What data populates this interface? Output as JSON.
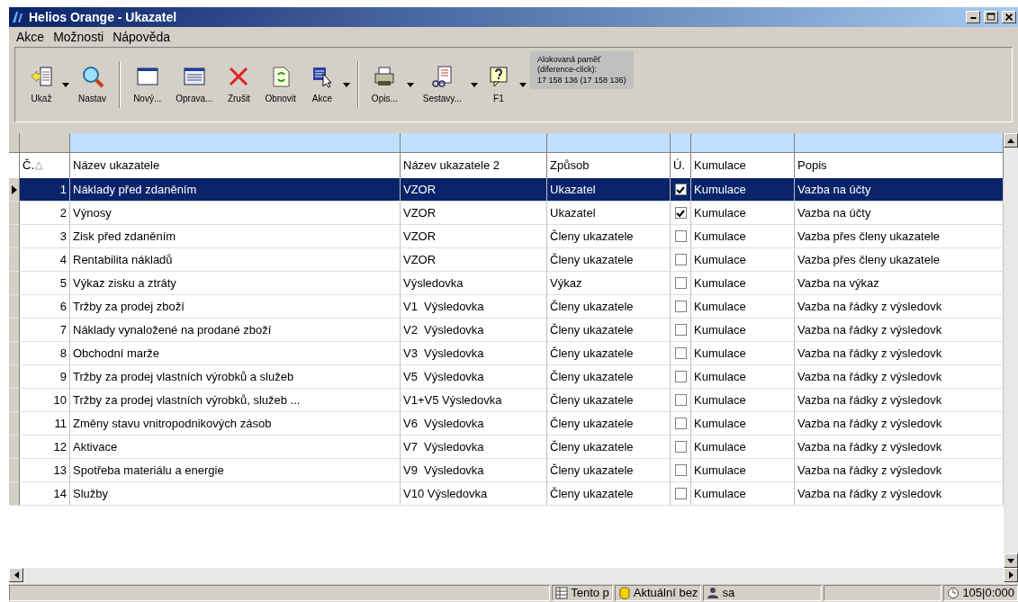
{
  "window": {
    "title": "Helios Orange - Ukazatel"
  },
  "menu": [
    "Akce",
    "Možnosti",
    "Nápověda"
  ],
  "toolbar": {
    "groups": [
      [
        {
          "label": "Ukaž",
          "dropdown": true
        },
        {
          "label": "Nastav",
          "dropdown": false
        }
      ],
      [
        {
          "label": "Nový...",
          "dropdown": false
        },
        {
          "label": "Oprava...",
          "dropdown": false
        },
        {
          "label": "Zrušit",
          "dropdown": false
        },
        {
          "label": "Obnovit",
          "dropdown": false
        },
        {
          "label": "Akce",
          "dropdown": true
        }
      ],
      [
        {
          "label": "Opis...",
          "dropdown": true
        },
        {
          "label": "Sestavy...",
          "dropdown": true
        },
        {
          "label": "F1",
          "dropdown": true
        }
      ]
    ],
    "memory": [
      "Alokovaná paměť",
      "(diference-click):",
      "17 158 136 (17 158 136)"
    ]
  },
  "table": {
    "columns": [
      "Č.",
      "Název ukazatele",
      "Název ukazatele 2",
      "Způsob",
      "Ú.",
      "Kumulace",
      "Popis"
    ],
    "rows": [
      {
        "number": "1",
        "name": "Náklady před zdaněním",
        "name2": "VZOR",
        "method": "Ukazatel",
        "checked": true,
        "cumulation": "Kumulace",
        "description": "Vazba na účty",
        "selected": true
      },
      {
        "number": "2",
        "name": "Výnosy",
        "name2": "VZOR",
        "method": "Ukazatel",
        "checked": true,
        "cumulation": "Kumulace",
        "description": "Vazba na účty",
        "selected": false
      },
      {
        "number": "3",
        "name": "Zisk před zdaněním",
        "name2": "VZOR",
        "method": "Členy ukazatele",
        "checked": false,
        "cumulation": "Kumulace",
        "description": "Vazba přes členy ukazatele",
        "selected": false
      },
      {
        "number": "4",
        "name": "Rentabilita nákladů",
        "name2": "VZOR",
        "method": "Členy ukazatele",
        "checked": false,
        "cumulation": "Kumulace",
        "description": "Vazba přes členy ukazatele",
        "selected": false
      },
      {
        "number": "5",
        "name": "Výkaz zisku a ztráty",
        "name2": "Výsledovka",
        "method": "Výkaz",
        "checked": false,
        "cumulation": "Kumulace",
        "description": "Vazba na výkaz",
        "selected": false
      },
      {
        "number": "6",
        "name": "Tržby za prodej zboží",
        "name2": "V1  Výsledovka",
        "method": "Členy ukazatele",
        "checked": false,
        "cumulation": "Kumulace",
        "description": "Vazba na řádky z výsledovk",
        "selected": false
      },
      {
        "number": "7",
        "name": "Náklady vynaložené na prodané zboží",
        "name2": "V2  Výsledovka",
        "method": "Členy ukazatele",
        "checked": false,
        "cumulation": "Kumulace",
        "description": "Vazba na řádky z výsledovk",
        "selected": false
      },
      {
        "number": "8",
        "name": "Obchodní marže",
        "name2": "V3  Výsledovka",
        "method": "Členy ukazatele",
        "checked": false,
        "cumulation": "Kumulace",
        "description": "Vazba na řádky z výsledovk",
        "selected": false
      },
      {
        "number": "9",
        "name": "Tržby za prodej vlastních výrobků a služeb",
        "name2": "V5  Výsledovka",
        "method": "Členy ukazatele",
        "checked": false,
        "cumulation": "Kumulace",
        "description": "Vazba na řádky z výsledovk",
        "selected": false
      },
      {
        "number": "10",
        "name": "Tržby za prodej vlastních výrobků, služeb ...",
        "name2": "V1+V5 Výsledovka",
        "method": "Členy ukazatele",
        "checked": false,
        "cumulation": "Kumulace",
        "description": "Vazba na řádky z výsledovk",
        "selected": false
      },
      {
        "number": "11",
        "name": "Změny stavu vnitropodnikových zásob",
        "name2": "V6  Výsledovka",
        "method": "Členy ukazatele",
        "checked": false,
        "cumulation": "Kumulace",
        "description": "Vazba na řádky z výsledovk",
        "selected": false
      },
      {
        "number": "12",
        "name": "Aktivace",
        "name2": "V7  Výsledovka",
        "method": "Členy ukazatele",
        "checked": false,
        "cumulation": "Kumulace",
        "description": "Vazba na řádky z výsledovk",
        "selected": false
      },
      {
        "number": "13",
        "name": "Spotřeba materiálu a energie",
        "name2": "V9  Výsledovka",
        "method": "Členy ukazatele",
        "checked": false,
        "cumulation": "Kumulace",
        "description": "Vazba na řádky z výsledovk",
        "selected": false
      },
      {
        "number": "14",
        "name": "Služby",
        "name2": "V10 Výsledovka",
        "method": "Členy ukazatele",
        "checked": false,
        "cumulation": "Kumulace",
        "description": "Vazba na řádky z výsledovk",
        "selected": false
      }
    ]
  },
  "status_bar": [
    "Tento p",
    "Aktuální bez",
    "sa",
    "105|0:000"
  ]
}
